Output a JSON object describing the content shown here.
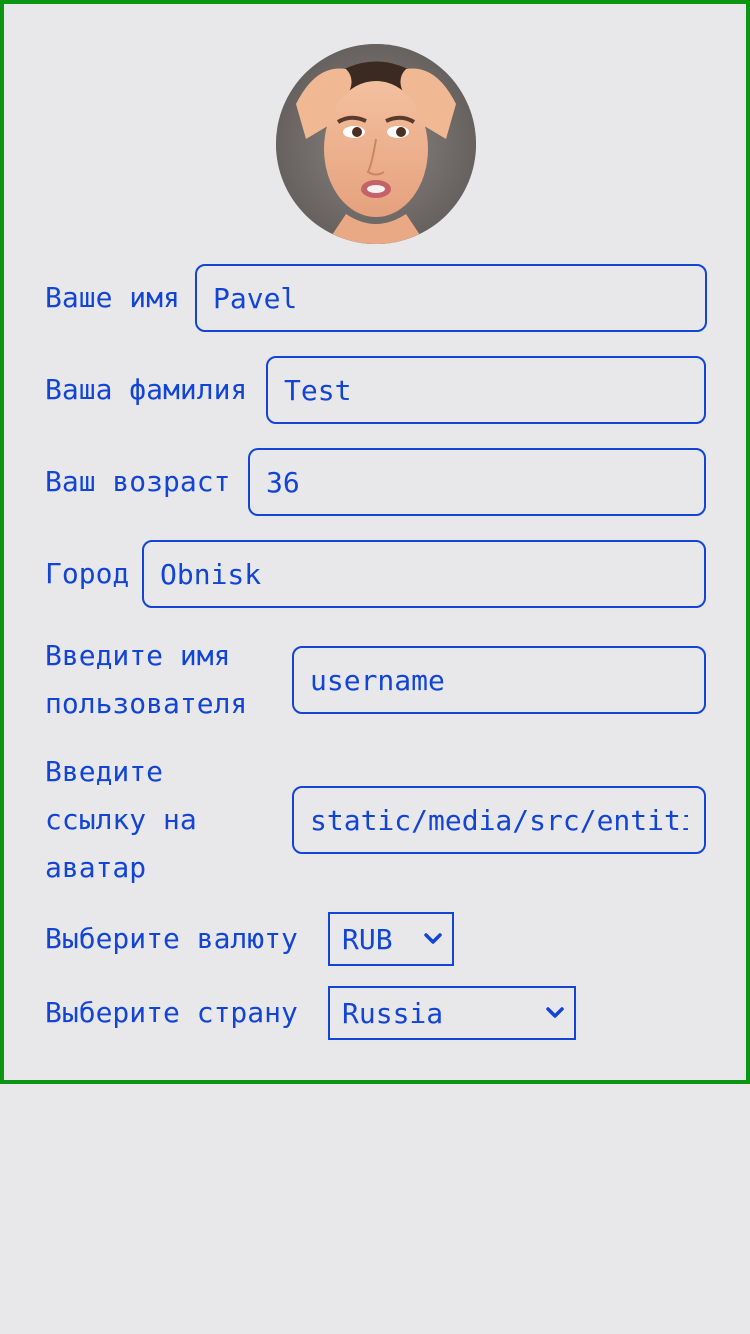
{
  "form": {
    "first_name": {
      "label": "Ваше имя",
      "value": "Pavel"
    },
    "last_name": {
      "label": "Ваша фамилия",
      "value": "Test"
    },
    "age": {
      "label": "Ваш возраст",
      "value": "36"
    },
    "city": {
      "label": "Город",
      "value": "Obnisk"
    },
    "username": {
      "label": "Введите имя пользователя",
      "value": "username"
    },
    "avatar_link": {
      "label": "Введите ссылку на аватар",
      "value": "static/media/src/entities/user/avatar.jpg"
    },
    "currency": {
      "label": "Выберите валюту",
      "value": "RUB"
    },
    "country": {
      "label": "Выберите страну",
      "value": "Russia"
    }
  },
  "colors": {
    "accent": "#1245d6",
    "frame": "#0c9412",
    "background": "#e8e7ea"
  },
  "icons": {
    "select_arrow": "chevron-down-icon"
  }
}
